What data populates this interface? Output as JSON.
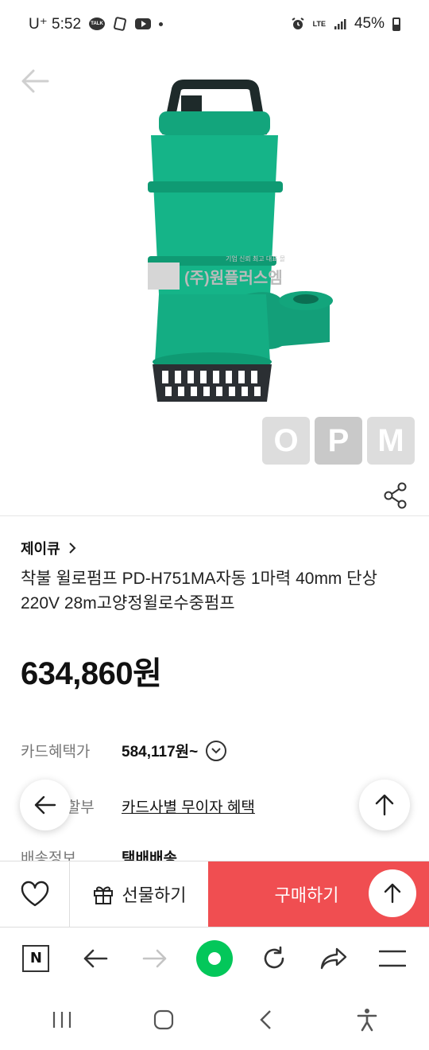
{
  "status_bar": {
    "carrier_time": "U⁺ 5:52",
    "talk_label": "TALK",
    "network": "LTE",
    "battery": "45%"
  },
  "hero": {
    "watermark_company": "(주)원플러스엠",
    "watermark_tagline": "기업 신뢰 최고 대표 몰",
    "opm_letters": [
      "O",
      "P",
      "M"
    ]
  },
  "product": {
    "store_name": "제이큐",
    "title": "착불 윌로펌프 PD-H751MA자동 1마력 40mm 단상220V 28m고양정윌로수중펌프",
    "price": "634,860원"
  },
  "info": {
    "card_label": "카드혜택가",
    "card_value": "584,117원~",
    "installment_label": "무이자 할부",
    "installment_value": "카드사별 무이자 혜택",
    "shipping_label": "배송정보",
    "shipping_value": "택배배송"
  },
  "buy_bar": {
    "gift_label": "선물하기",
    "buy_label": "구매하기"
  },
  "browser_bar": {
    "n_label": "N"
  },
  "colors": {
    "buy_red": "#f04e51",
    "naver_green": "#03c75a",
    "pump_green": "#14b889"
  }
}
